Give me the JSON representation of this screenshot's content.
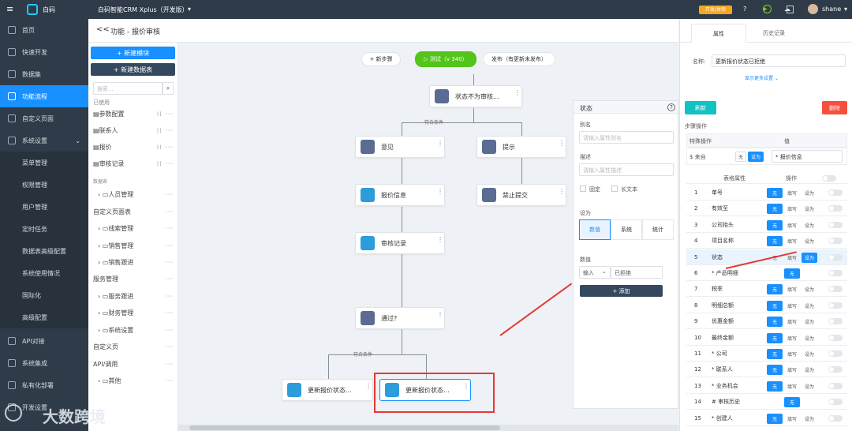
{
  "topbar": {
    "logo": "白码",
    "app": "白码智能CRM Xplus（开发版）",
    "badge": "开发/体验",
    "user": "shane"
  },
  "sidebar": {
    "items": [
      "首页",
      "快速开发",
      "数据集",
      "功能流程",
      "自定义页面",
      "系统设置",
      "API对接",
      "系统集成",
      "私有化部署"
    ],
    "sub": [
      "菜单管理",
      "权限管理",
      "用户管理",
      "定时任务",
      "数据表高级配置",
      "系统使用情况",
      "国际化",
      "高级配置"
    ],
    "bottom": "开发设置"
  },
  "header": {
    "back": "<<",
    "title": "功能 - 报价审核"
  },
  "panel": {
    "new_module": "+ 新建模块",
    "new_table": "+ 新建数据表",
    "search_placeholder": "搜索...",
    "used": "已使用",
    "used_items": [
      "参数配置",
      "联系人",
      "报价",
      "审核记录"
    ],
    "tables": "数据表",
    "tree": [
      "人员管理",
      "自定义页面表",
      "线索管理",
      "销售管理",
      "销售跟进",
      "服务管理",
      "服务跟进",
      "财务管理",
      "系统设置",
      "自定义页",
      "API/调用",
      "其他"
    ]
  },
  "canvas": {
    "add_step": "+ 新步骤",
    "test": "▷ 测试（v 340）",
    "publish": "发布（有更新未发布）",
    "cond1": "符合条件",
    "cond2": "符合条件",
    "nodes": [
      "状态不为审核...",
      "意见",
      "提示",
      "报价信息",
      "禁止提交",
      "审核记录",
      "通过?",
      "更新报价状态...",
      "更新报价状态..."
    ]
  },
  "state": {
    "title": "状态",
    "alias_label": "别名",
    "alias_ph": "请输入属性别名",
    "desc_label": "描述",
    "desc_ph": "请输入属性描述",
    "fixed": "固定",
    "richtext": "长文本",
    "setas": "设为",
    "opts": [
      "数值",
      "系统",
      "统计"
    ],
    "value_label": "数值",
    "input_type": "输入",
    "value": "已拒绝",
    "add": "+ 添加"
  },
  "right": {
    "tabs": [
      "属性",
      "历史记录"
    ],
    "name_label": "名称:",
    "name_value": "更新报价状态已拒绝",
    "more": "显示更多设置 ⌄",
    "refresh": "刷新",
    "delete": "删除",
    "step_ops": "步骤操作",
    "special": "特殊操作",
    "val": "值",
    "from": "$ 来自",
    "none": "无",
    "setto": "设为",
    "source": "* 报价信息",
    "col_attr": "表格属性",
    "col_op": "操作",
    "rows": [
      [
        "1",
        "单号"
      ],
      [
        "2",
        "有效至"
      ],
      [
        "3",
        "公司抬头"
      ],
      [
        "4",
        "项目名称"
      ],
      [
        "5",
        "状态"
      ],
      [
        "6",
        "* 产品明细"
      ],
      [
        "7",
        "税率"
      ],
      [
        "8",
        "明细总额"
      ],
      [
        "9",
        "优惠金额"
      ],
      [
        "10",
        "最终金额"
      ],
      [
        "11",
        "* 公司"
      ],
      [
        "12",
        "* 联系人"
      ],
      [
        "13",
        "* 业务机会"
      ],
      [
        "14",
        "# 审核历史"
      ],
      [
        "15",
        "* 创建人"
      ]
    ],
    "ops": [
      "无",
      "填写",
      "设为"
    ]
  },
  "watermark": "大数跨境",
  "colors": {
    "accent": "#1890ff",
    "nav": "#2f3b48",
    "test": "#52c41a",
    "danger": "#f5503d",
    "arrow": "#e53935"
  }
}
